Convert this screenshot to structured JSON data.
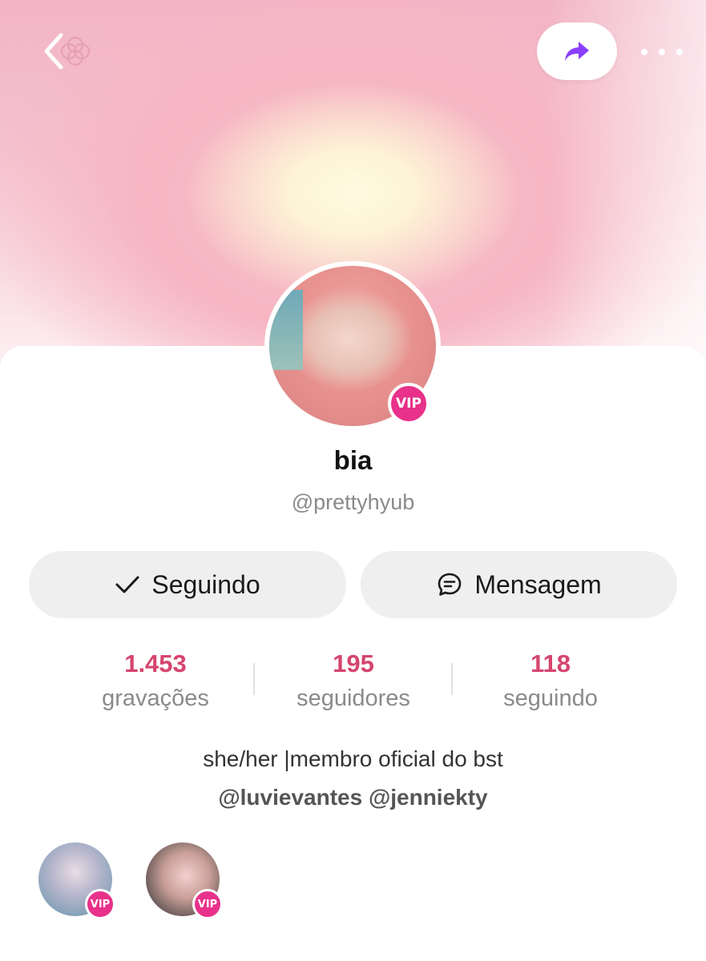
{
  "header": {
    "back_icon": "chevron-left-icon",
    "share_icon": "share-arrow-icon",
    "more_icon": "more-dots-icon",
    "accent_color": "#8a3ffc"
  },
  "profile": {
    "name": "bia",
    "handle": "@prettyhyub",
    "badge": "VIP",
    "badge_color": "#e8318a"
  },
  "actions": {
    "follow_label": "Seguindo",
    "message_label": "Mensagem"
  },
  "stats": [
    {
      "value": "1.453",
      "label": "gravações"
    },
    {
      "value": "195",
      "label": "seguidores"
    },
    {
      "value": "118",
      "label": "seguindo"
    }
  ],
  "stats_color": "#d6456e",
  "bio": {
    "line1": "she/her |membro oficial do bst",
    "line2": "@luvievantes @jenniekty"
  },
  "linked_accounts": [
    {
      "badge": "VIP"
    },
    {
      "badge": "VIP"
    }
  ]
}
